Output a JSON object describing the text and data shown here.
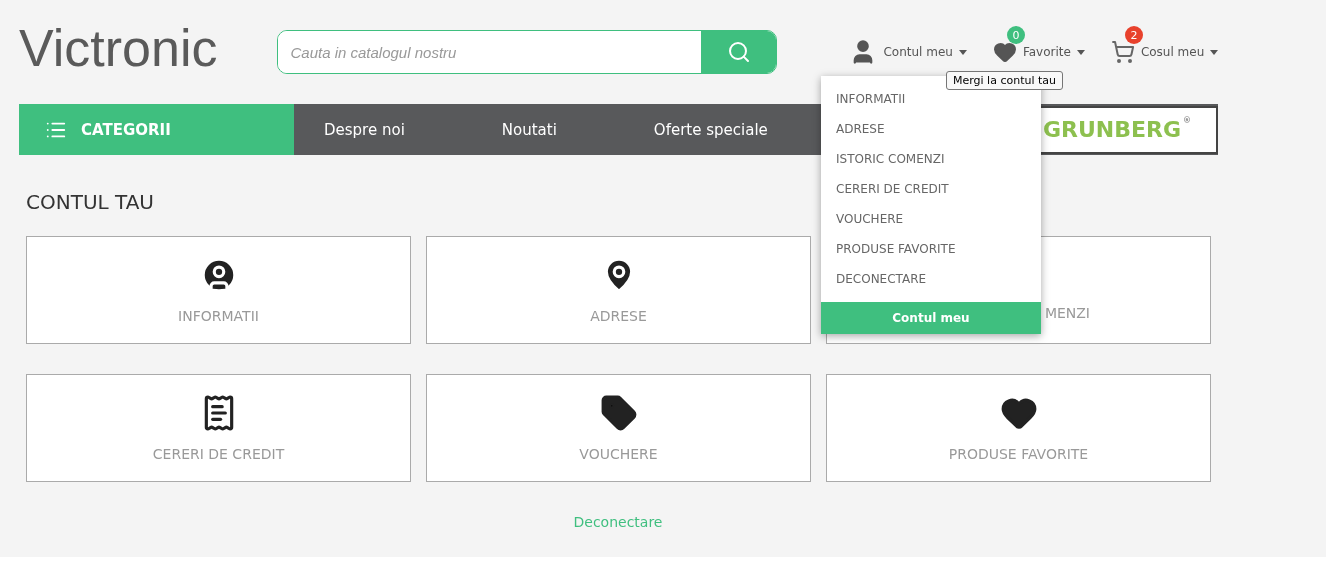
{
  "logo": {
    "text": "Victronic"
  },
  "search": {
    "placeholder": "Cauta in catalogul nostru"
  },
  "account": {
    "label": "Contul meu"
  },
  "favorites": {
    "label": "Favorite",
    "count": "0"
  },
  "cart": {
    "label": "Cosul meu",
    "count": "2"
  },
  "tooltip": "Mergi la contul tau",
  "nav": {
    "categories": "CATEGORII",
    "links": [
      "Despre noi",
      "Noutati",
      "Oferte speciale"
    ],
    "brand": "GRUNBERG",
    "brand_mark": "®"
  },
  "dropdown": {
    "items": [
      "INFORMATII",
      "ADRESE",
      "ISTORIC COMENZI",
      "CERERI DE CREDIT",
      "VOUCHERE",
      "PRODUSE FAVORITE",
      "DECONECTARE"
    ],
    "footer": "Contul meu"
  },
  "page_title": "CONTUL TAU",
  "cards": [
    {
      "kind": "user",
      "label": "INFORMATII"
    },
    {
      "kind": "pin",
      "label": "ADRESE"
    },
    {
      "kind": "covered",
      "label": "MENZI"
    },
    {
      "kind": "receipt",
      "label": "CERERI DE CREDIT"
    },
    {
      "kind": "tag",
      "label": "VOUCHERE"
    },
    {
      "kind": "heart",
      "label": "PRODUSE FAVORITE"
    }
  ],
  "logout": "Deconectare"
}
